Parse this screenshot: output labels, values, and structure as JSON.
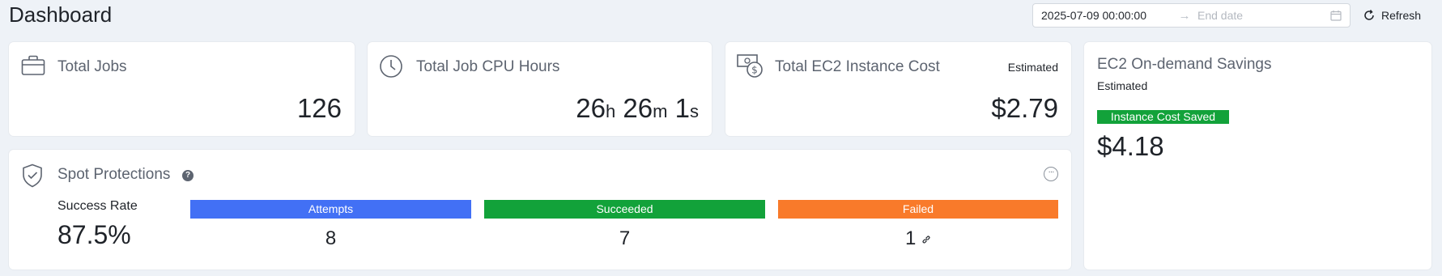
{
  "header": {
    "title": "Dashboard",
    "date_start": "2025-07-09 00:00:00",
    "date_end_placeholder": "End date",
    "refresh_label": "Refresh"
  },
  "cards": {
    "total_jobs": {
      "title": "Total Jobs",
      "value": "126"
    },
    "cpu_hours": {
      "title": "Total Job CPU Hours",
      "hours": "26",
      "hours_unit": "h",
      "minutes": "26",
      "minutes_unit": "m",
      "seconds": "1",
      "seconds_unit": "s"
    },
    "ec2_cost": {
      "title": "Total EC2 Instance Cost",
      "badge": "Estimated",
      "value": "$2.79"
    },
    "savings": {
      "title": "EC2 On-demand Savings",
      "subtitle": "Estimated",
      "tag": "Instance Cost Saved",
      "tag_color": "#12a23a",
      "value": "$4.18"
    }
  },
  "spot": {
    "title": "Spot Protections",
    "success_rate_label": "Success Rate",
    "success_rate_value": "87.5%",
    "attempts_label": "Attempts",
    "attempts_value": "8",
    "attempts_color": "#4270f5",
    "succeeded_label": "Succeeded",
    "succeeded_value": "7",
    "succeeded_color": "#12a23a",
    "failed_label": "Failed",
    "failed_value": "1",
    "failed_color": "#f97a2a"
  },
  "icons": {
    "briefcase": "briefcase-icon",
    "clock": "clock-icon",
    "money": "money-icon",
    "shield": "shield-check-icon",
    "help": "help-icon",
    "more": "more-icon",
    "link": "link-icon",
    "calendar": "calendar-icon",
    "refresh": "refresh-icon"
  }
}
